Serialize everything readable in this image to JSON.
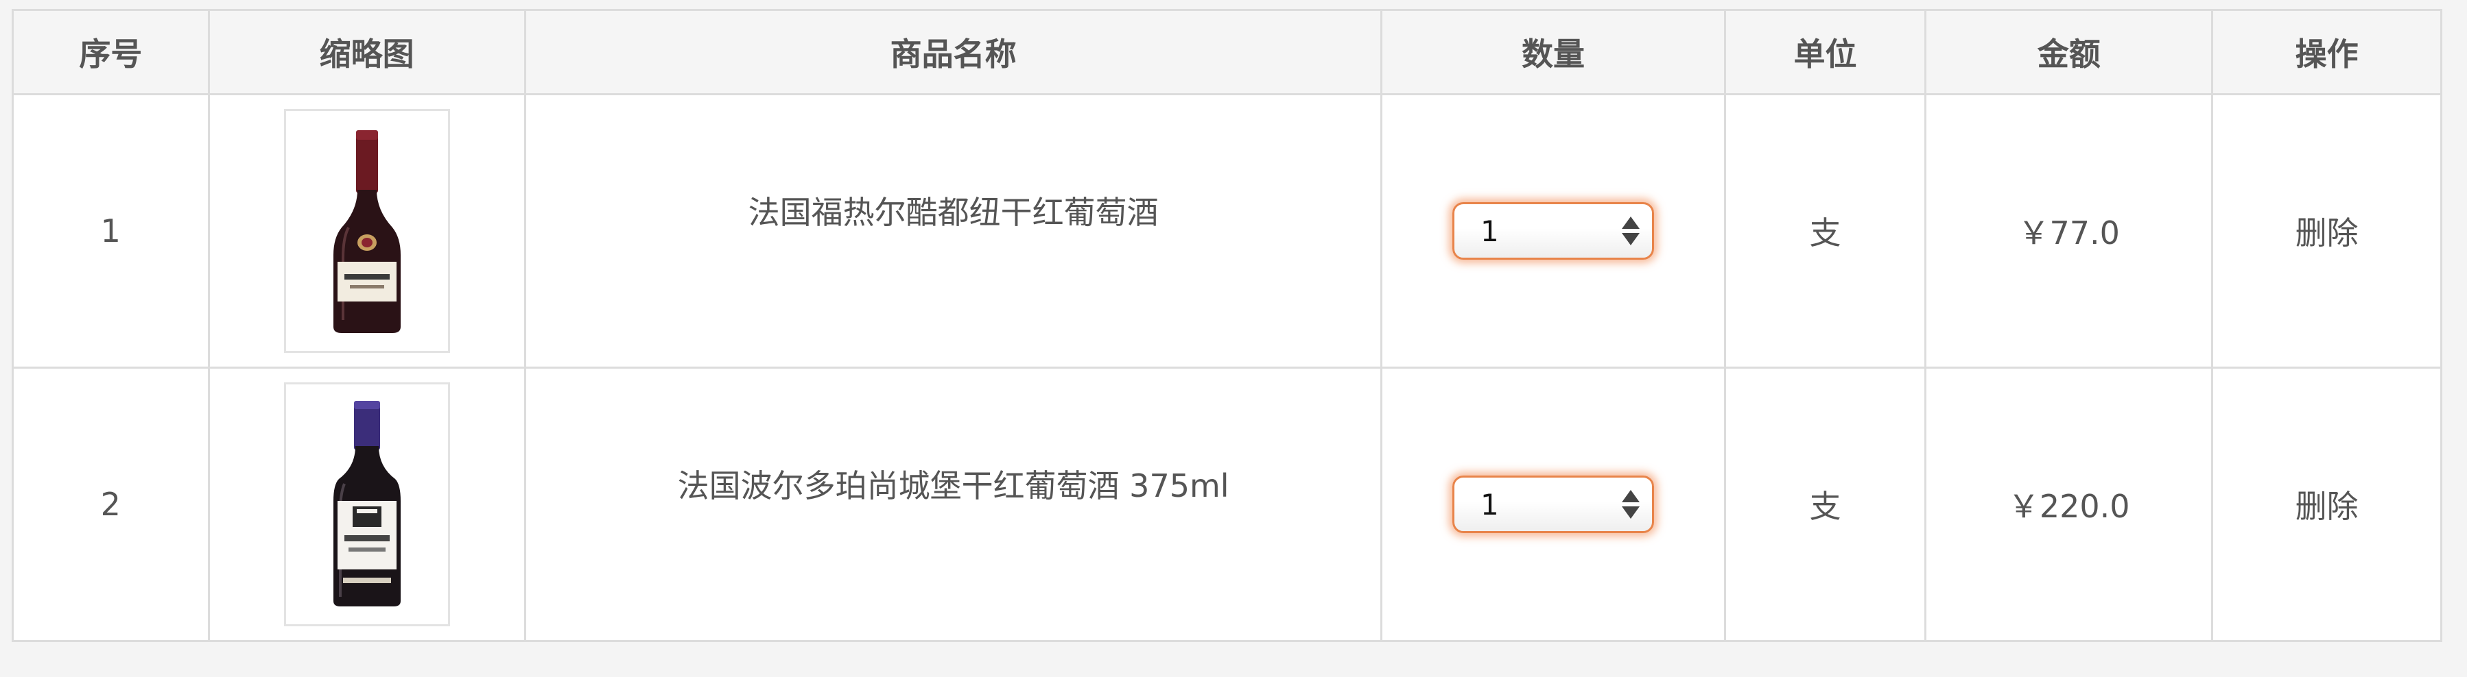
{
  "table": {
    "headers": {
      "index": "序号",
      "thumbnail": "缩略图",
      "name": "商品名称",
      "quantity": "数量",
      "unit": "单位",
      "amount": "金额",
      "operation": "操作"
    },
    "rows": [
      {
        "index": "1",
        "thumbnail_icon": "wine-bottle-icon",
        "name": "法国福热尔酷都纽干红葡萄酒",
        "quantity": "1",
        "unit": "支",
        "amount": "￥77.0",
        "delete_label": "删除"
      },
      {
        "index": "2",
        "thumbnail_icon": "wine-bottle-icon",
        "name": "法国波尔多珀尚城堡干红葡萄酒 375ml",
        "quantity": "1",
        "unit": "支",
        "amount": "￥220.0",
        "delete_label": "删除"
      }
    ]
  },
  "colors": {
    "header_bg": "#f5f5f5",
    "border": "#dcdcdc",
    "stepper_focus": "#e8844a",
    "bottle1_glass": "#2a1216",
    "bottle1_capsule": "#6b1a22",
    "bottle2_glass": "#1a1418",
    "bottle2_capsule": "#3b2d7a"
  }
}
